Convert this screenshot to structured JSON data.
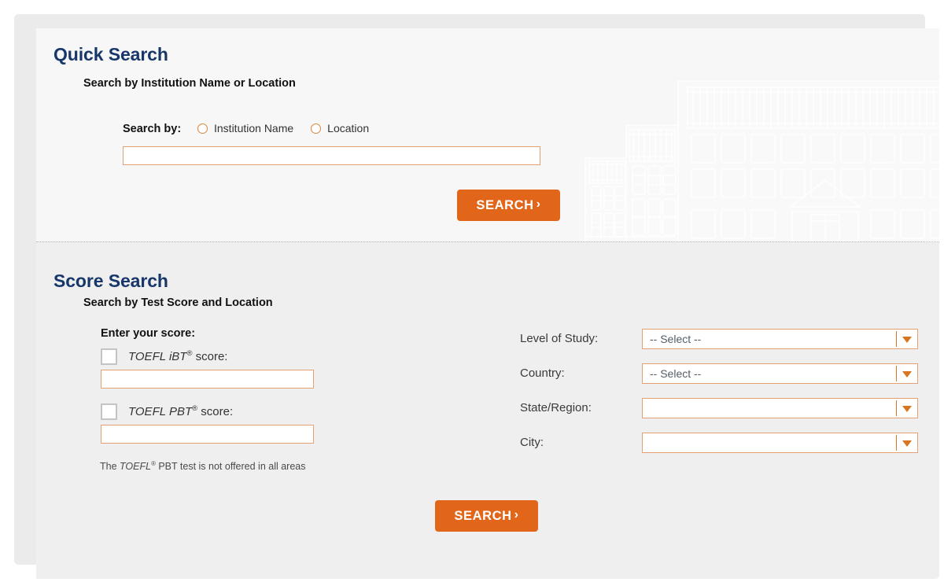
{
  "quick_search": {
    "title": "Quick Search",
    "subtitle": "Search by Institution Name or Location",
    "search_by_label": "Search by:",
    "radio_options": [
      {
        "label": "Institution Name",
        "selected": false
      },
      {
        "label": "Location",
        "selected": false
      }
    ],
    "input_value": "",
    "input_placeholder": "",
    "search_button": "SEARCH",
    "search_button_chevron": "›"
  },
  "score_search": {
    "title": "Score Search",
    "subtitle": "Search by Test Score and Location",
    "enter_score_label": "Enter your score:",
    "ibt": {
      "checked": false,
      "label_prefix": "TOEFL iBT",
      "label_sup": "®",
      "label_suffix": " score:",
      "input_value": ""
    },
    "pbt": {
      "checked": false,
      "label_prefix": "TOEFL PBT",
      "label_sup": "®",
      "label_suffix": " score:",
      "input_value": ""
    },
    "note": {
      "before": "The ",
      "italic": "TOEFL",
      "sup": "®",
      "after": " PBT test is not offered in all areas"
    },
    "filters": [
      {
        "label": "Level of Study:",
        "value": "-- Select --"
      },
      {
        "label": "Country:",
        "value": "-- Select --"
      },
      {
        "label": "State/Region:",
        "value": ""
      },
      {
        "label": "City:",
        "value": ""
      }
    ],
    "search_button": "SEARCH",
    "search_button_chevron": "›"
  },
  "colors": {
    "heading_navy": "#17376b",
    "accent_orange": "#e2661a",
    "input_border": "#e2a175",
    "dropdown_accent": "#d9741f",
    "panel_top_bg": "#f7f7f7",
    "panel_bottom_bg": "#efefef",
    "frame_bg": "#ebebeb",
    "checkbox_border": "#c4c4c4"
  },
  "decoration": {
    "watermark": "campus-buildings-illustration"
  }
}
